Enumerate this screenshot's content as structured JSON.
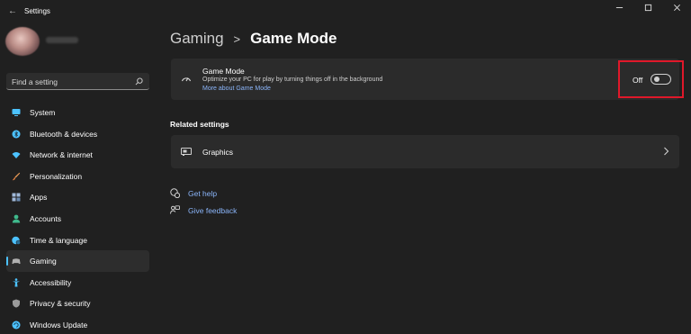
{
  "window": {
    "title": "Settings",
    "controls": [
      "minimize",
      "maximize",
      "close"
    ]
  },
  "sidebar": {
    "search_placeholder": "Find a setting",
    "items": [
      {
        "label": "System",
        "icon": "monitor-icon",
        "color": "#4cc2ff"
      },
      {
        "label": "Bluetooth & devices",
        "icon": "bluetooth-icon",
        "color": "#4cc2ff"
      },
      {
        "label": "Network & internet",
        "icon": "wifi-icon",
        "color": "#4cc2ff"
      },
      {
        "label": "Personalization",
        "icon": "brush-icon",
        "color": "#f0a05a"
      },
      {
        "label": "Apps",
        "icon": "apps-icon",
        "color": "#9fb8d8"
      },
      {
        "label": "Accounts",
        "icon": "person-icon",
        "color": "#3fb98c"
      },
      {
        "label": "Time & language",
        "icon": "globe-clock-icon",
        "color": "#4cc2ff"
      },
      {
        "label": "Gaming",
        "icon": "controller-icon",
        "color": "#b0b0b0",
        "active": true
      },
      {
        "label": "Accessibility",
        "icon": "accessibility-icon",
        "color": "#4cc2ff"
      },
      {
        "label": "Privacy & security",
        "icon": "shield-icon",
        "color": "#9a9a9a"
      },
      {
        "label": "Windows Update",
        "icon": "sync-icon",
        "color": "#4cc2ff"
      }
    ]
  },
  "breadcrumb": {
    "parent": "Gaming",
    "separator": ">",
    "current": "Game Mode"
  },
  "game_mode": {
    "title": "Game Mode",
    "description": "Optimize your PC for play by turning things off in the background",
    "link": "More about Game Mode",
    "toggle_label": "Off",
    "toggle_on": false
  },
  "related": {
    "title": "Related settings",
    "items": [
      {
        "label": "Graphics",
        "icon": "graphics-icon"
      }
    ]
  },
  "help": {
    "get_help": "Get help",
    "give_feedback": "Give feedback"
  },
  "colors": {
    "accent": "#4cc2ff",
    "link": "#8ab4f8",
    "highlight": "#e0182a"
  }
}
